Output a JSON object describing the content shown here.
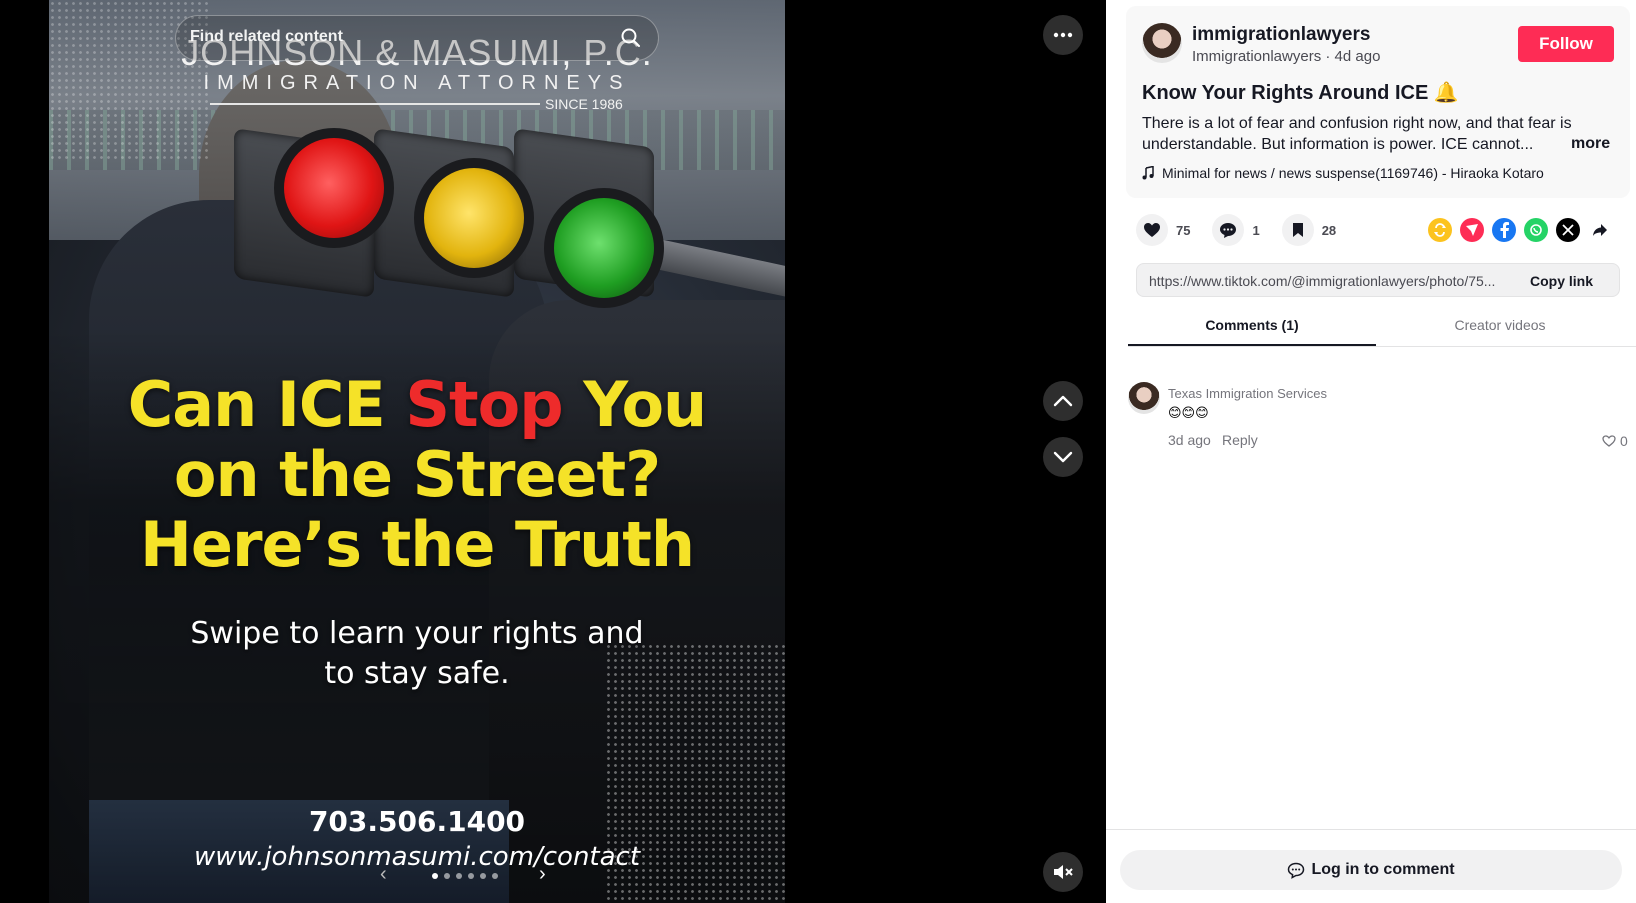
{
  "search": {
    "placeholder": "Find related content"
  },
  "media": {
    "brand_name": "JOHNSON & MASUMI, P.C.",
    "brand_sub": "IMMIGRATION ATTORNEYS",
    "brand_since": "SINCE 1986",
    "headline_part1": "Can ICE ",
    "headline_part2": "Stop",
    "headline_part3": " You",
    "headline_line2": "on the Street?",
    "headline_line3": "Here’s the Truth",
    "subline_line1": "Swipe to learn your rights and",
    "subline_line2": "to stay safe.",
    "phone": "703.506.1400",
    "website": "www.johnsonmasumi.com/contact",
    "carousel_total": 6,
    "carousel_active": 1
  },
  "controls": {
    "more_icon": "more-horizontal-icon",
    "up_icon": "chevron-up-icon",
    "down_icon": "chevron-down-icon",
    "mute_icon": "muted-speaker-icon"
  },
  "post": {
    "author_name": "immigrationlawyers",
    "author_meta": "Immigrationlawyers · 4d ago",
    "follow_label": "Follow",
    "title": "Know Your Rights Around ICE 🔔",
    "description": "There is a lot of fear and confusion right now, and that fear is understandable. But information is power. ICE cannot...",
    "more_label": "more",
    "music": "Minimal for news / news suspense(1169746) - Hiraoka Kotaro"
  },
  "actions": {
    "likes": "75",
    "comments": "1",
    "saves": "28"
  },
  "link": {
    "url": "https://www.tiktok.com/@immigrationlawyers/photo/75...",
    "copy_label": "Copy link"
  },
  "tabs": {
    "comments_label": "Comments (1)",
    "creator_label": "Creator videos"
  },
  "comment": {
    "author": "Texas Immigration Services",
    "text": "😊😊😊",
    "time": "3d ago",
    "reply_label": "Reply",
    "likes": "0"
  },
  "login": {
    "label": "Log in to comment"
  },
  "colors": {
    "accent": "#fe2c55",
    "headline_yellow": "#f5e228",
    "headline_red": "#ee2b2b",
    "repost": "#fcc31e",
    "send": "#fe2c55",
    "facebook": "#1877f2",
    "whatsapp": "#25d366",
    "x": "#000000"
  }
}
